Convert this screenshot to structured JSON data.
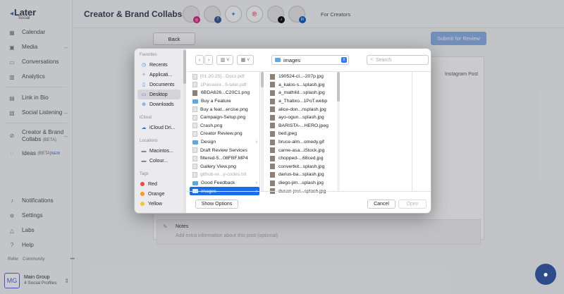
{
  "sidebar": {
    "logo": {
      "word": "Later",
      "sub": "Social"
    },
    "items": [
      {
        "label": "Calendar",
        "icon": "calendar-icon"
      },
      {
        "label": "Media",
        "icon": "image-icon",
        "arrow": "→"
      },
      {
        "label": "Conversations",
        "icon": "chat-icon"
      },
      {
        "label": "Analytics",
        "icon": "chart-icon"
      },
      {
        "label": "Link in Bio",
        "icon": "link-icon"
      },
      {
        "label": "Social Listening",
        "icon": "listening-icon",
        "arrow": "→"
      },
      {
        "label": "Creator & Brand",
        "label2": "Collabs",
        "beta": "(BETA)",
        "icon": "collab-icon",
        "arrow": "→"
      },
      {
        "label": "Ideas",
        "beta": "(BETA)",
        "new": "NEW",
        "icon": "bulb-icon"
      }
    ],
    "bottom_items": [
      {
        "label": "Notifications",
        "icon": "bell-icon"
      },
      {
        "label": "Settings",
        "icon": "gear-icon"
      },
      {
        "label": "Labs",
        "icon": "flask-icon"
      },
      {
        "label": "Help",
        "icon": "help-icon"
      }
    ],
    "refer": "Refer",
    "community": "Community",
    "more": "•••",
    "group": {
      "initials": "MG",
      "name": "Main Group",
      "profiles": "4 Social Profiles"
    }
  },
  "header": {
    "title": "Creator & Brand Collabs",
    "for_creators": "For Creators",
    "profiles": [
      {
        "badge": "instagram",
        "color": "#d6297a"
      },
      {
        "badge": "facebook",
        "color": "#3b5998"
      },
      {
        "badge": "twitter",
        "color": "#1da1f2"
      },
      {
        "badge": "pinterest",
        "color": "#e60023"
      },
      {
        "badge": "tiktok",
        "color": "#111111"
      },
      {
        "badge": "linkedin",
        "color": "#0a66c2"
      }
    ]
  },
  "page": {
    "back_label": "Back",
    "submit_label": "Submit for Review",
    "instagram_post": "Instagram Post",
    "notes_title": "Notes",
    "notes_placeholder": "Add extra information about this post (optional)"
  },
  "dialog": {
    "sidebar": {
      "favorites_title": "Favorites",
      "favorites": [
        {
          "label": "Recents",
          "icon": "clock-icon"
        },
        {
          "label": "Applicati...",
          "icon": "apps-icon"
        },
        {
          "label": "Documents",
          "icon": "document-icon"
        },
        {
          "label": "Desktop",
          "icon": "desktop-icon",
          "selected": true
        },
        {
          "label": "Downloads",
          "icon": "download-icon"
        }
      ],
      "icloud_title": "iCloud",
      "icloud": [
        {
          "label": "iCloud Dri...",
          "icon": "cloud-icon"
        }
      ],
      "locations_title": "Locations",
      "locations": [
        {
          "label": "Macintos...",
          "icon": "disk-icon"
        },
        {
          "label": "Colour...",
          "icon": "disk-icon"
        }
      ],
      "tags_title": "Tags",
      "tags": [
        {
          "label": "Red",
          "color": "#f04a3b"
        },
        {
          "label": "Orange",
          "color": "#f59a23"
        },
        {
          "label": "Yellow",
          "color": "#f5c723"
        }
      ]
    },
    "location": "images",
    "search_placeholder": "Search",
    "column1": [
      {
        "name": "[01.20.25]...Docs.pdf",
        "type": "file",
        "faded": true
      },
      {
        "name": "1Passwor...5-later.pdf",
        "type": "file",
        "faded": true
      },
      {
        "name": "6BDA626...C20C1.png",
        "type": "image"
      },
      {
        "name": "Buy a Feature",
        "type": "folder"
      },
      {
        "name": "Buy a feat...ercise.png",
        "type": "file"
      },
      {
        "name": "Campaign-Setup.png",
        "type": "file"
      },
      {
        "name": "Crash.png",
        "type": "file"
      },
      {
        "name": "Creator Review.png",
        "type": "file"
      },
      {
        "name": "Design",
        "type": "folder",
        "chev": true
      },
      {
        "name": "Draft Review Services",
        "type": "file"
      },
      {
        "name": "filtered-5...08FBF.MP4",
        "type": "file"
      },
      {
        "name": "Gallery View.png",
        "type": "file"
      },
      {
        "name": "github-re...y-codes.txt",
        "type": "file",
        "faded": true
      },
      {
        "name": "Good Feedback",
        "type": "folder",
        "chev": true
      },
      {
        "name": "images",
        "type": "folder",
        "chev": true,
        "selected": true
      }
    ],
    "column2": [
      "190524-cl...-207p.jpg",
      "a_kalos-s...splash.jpg",
      "a_mathild...splash.jpg",
      "a_Thatixo...1PoT.webp",
      "alice-don...nsplash.jpg",
      "ayo-ogun...splash.jpg",
      "BARISTA-...HERO.jpeg",
      "bed.jpeg",
      "bruce-alm...omedy.gif",
      "carne-asa...iStock.jpg",
      "chopped-...68ced.jpg",
      "convertkit...splash.jpg",
      "darius-ba...splash.jpg",
      "diego-jim...splash.jpg",
      "dusan-jevi...splash.jpg"
    ],
    "show_options": "Show Options",
    "cancel": "Cancel",
    "open": "Open"
  }
}
